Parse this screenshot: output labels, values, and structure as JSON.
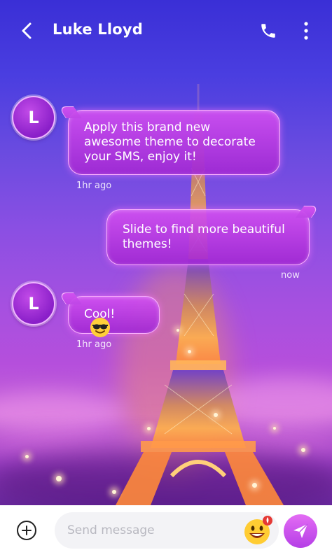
{
  "header": {
    "contact_name": "Luke Lloyd",
    "back_icon": "back-arrow-icon",
    "call_icon": "phone-icon",
    "menu_icon": "more-vertical-icon"
  },
  "messages": [
    {
      "direction": "incoming",
      "avatar_letter": "L",
      "text": "Apply this brand new awesome theme to decorate your SMS, enjoy it!",
      "time": "1hr ago"
    },
    {
      "direction": "outgoing",
      "text": "Slide to find more beautiful themes!",
      "time": "now"
    },
    {
      "direction": "incoming",
      "avatar_letter": "L",
      "text": "Cool!",
      "emoji": "sunglasses-emoji-icon",
      "time": "1hr ago"
    }
  ],
  "composer": {
    "add_icon": "plus-circle-icon",
    "placeholder": "Send message",
    "emoji_icon": "grinning-emoji-icon",
    "send_icon": "send-icon"
  },
  "colors": {
    "accent": "#c24be8",
    "bubble": "#b63fe0",
    "send_button": "#d05cf0"
  }
}
